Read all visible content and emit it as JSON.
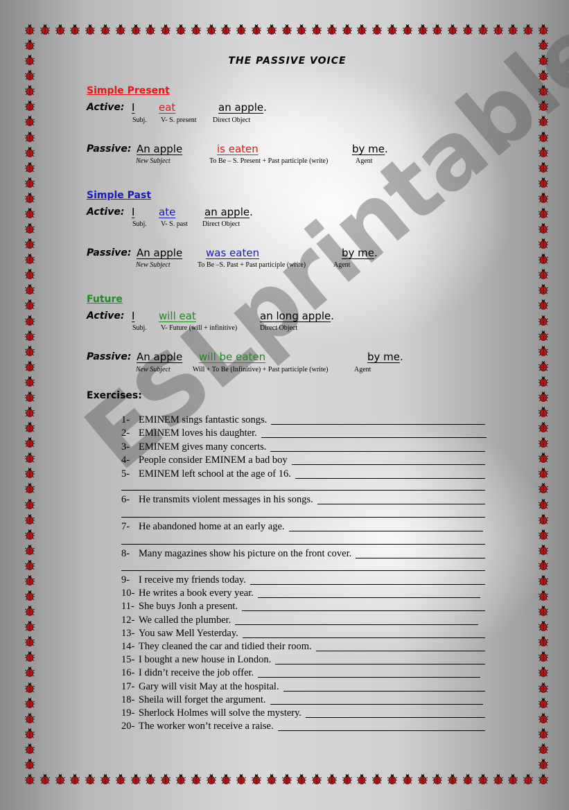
{
  "title": "THE PASSIVE VOICE",
  "colors": {
    "present": "#e8141c",
    "past": "#1a1ab8",
    "future": "#1f8a1f",
    "bug_red": "#b01818",
    "text": "#000000"
  },
  "sections": [
    {
      "heading": "Simple Present",
      "active": {
        "label": "Active:",
        "subject": "I",
        "verb": "eat",
        "object": "an apple",
        "end": ".",
        "notes": [
          "Subj.",
          "V- S. present",
          "Direct Object"
        ]
      },
      "passive": {
        "label": "Passive:",
        "subject": "An apple",
        "verb": "is eaten",
        "agent": "by me",
        "end": ".",
        "notes": [
          "New Subject",
          "To Be – S. Present + Past participle (write)",
          "Agent"
        ]
      }
    },
    {
      "heading": "Simple Past",
      "active": {
        "label": "Active:",
        "subject": "I",
        "verb": "ate",
        "object": "an apple",
        "end": ".",
        "notes": [
          "Subj.",
          "V- S. past",
          "Direct Object"
        ]
      },
      "passive": {
        "label": "Passive:",
        "subject": "An apple",
        "verb": "was eaten",
        "agent": "by me",
        "end": ".",
        "notes": [
          "New Subject",
          "To Be –S. Past + Past participle (write)",
          "Agent"
        ]
      }
    },
    {
      "heading": "Future",
      "active": {
        "label": "Active:",
        "subject": "I",
        "verb": "will eat",
        "object": "an long apple",
        "end": ".",
        "notes": [
          "Subj.",
          "V-  Future (will + infinitive)",
          "Direct Object"
        ]
      },
      "passive": {
        "label": "Passive:",
        "subject": "An apple",
        "verb": "will be eaten",
        "agent": "by me",
        "end": ".",
        "notes": [
          "New Subject",
          "Will + To Be (Infinitive) + Past participle (write)",
          "Agent"
        ]
      }
    }
  ],
  "exercises": {
    "heading": "Exercises:",
    "items": [
      {
        "num": "1-",
        "text": "EMINEM sings fantastic songs."
      },
      {
        "num": "2-",
        "text": "EMINEM loves his daughter."
      },
      {
        "num": "3-",
        "text": "EMINEM gives many concerts."
      },
      {
        "num": "4-",
        "text": "People consider EMINEM a bad boy"
      },
      {
        "num": "5-",
        "text": "EMINEM left school at the age of 16."
      },
      {
        "num": "6-",
        "text": "He transmits violent messages in his songs."
      },
      {
        "num": "7-",
        "text": "He abandoned home at an early age."
      },
      {
        "num": "8-",
        "text": "Many magazines show his picture on the front cover."
      },
      {
        "num": "9-",
        "text": "I receive my friends today."
      },
      {
        "num": "10-",
        "text": "He writes a book every year."
      },
      {
        "num": "11-",
        "text": "She buys Jonh a present."
      },
      {
        "num": "12-",
        "text": "We called the plumber."
      },
      {
        "num": "13-",
        "text": "You saw Mell Yesterday."
      },
      {
        "num": "14-",
        "text": "They cleaned the car and tidied their room."
      },
      {
        "num": "15-",
        "text": "I bought a new house in London."
      },
      {
        "num": "16-",
        "text": "I didn’t receive the job offer."
      },
      {
        "num": "17-",
        "text": "Gary will visit May at the hospital."
      },
      {
        "num": "18-",
        "text": "Sheila will forget the argument."
      },
      {
        "num": "19-",
        "text": "Sherlock Holmes will solve the mystery."
      },
      {
        "num": "20-",
        "text": "The worker won’t receive a raise."
      }
    ]
  },
  "watermark": "ESLprintables.com",
  "border_icon": "ladybug-icon"
}
